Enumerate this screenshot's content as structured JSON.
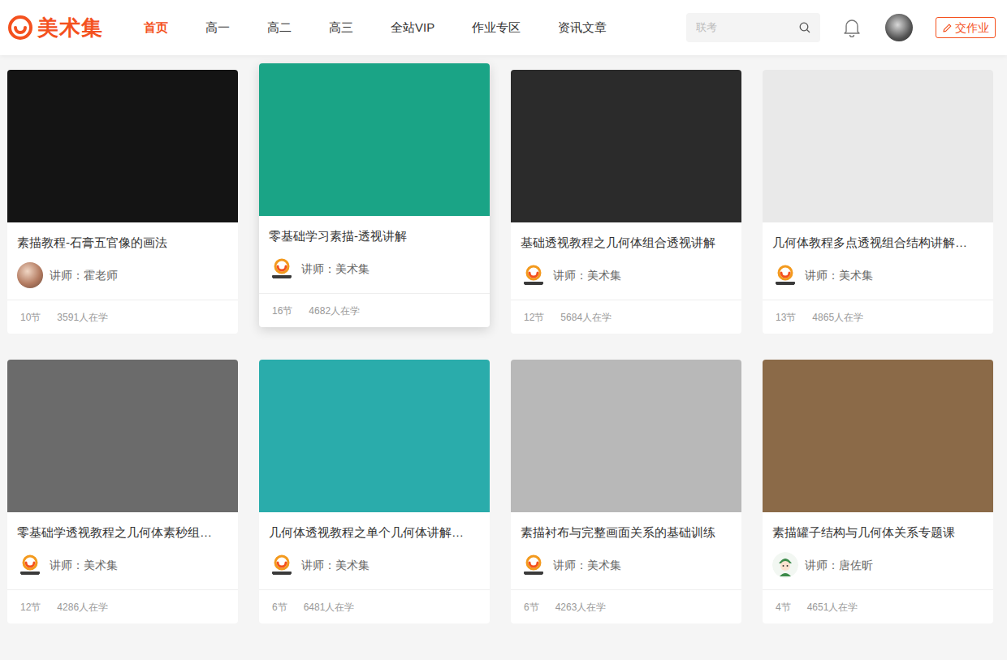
{
  "header": {
    "logo": {
      "text": "美术集"
    },
    "nav": [
      {
        "label": "首页",
        "selected": true
      },
      {
        "label": "高一",
        "selected": false
      },
      {
        "label": "高二",
        "selected": false
      },
      {
        "label": "高三",
        "selected": false
      },
      {
        "label": "全站VIP",
        "selected": false
      },
      {
        "label": "作业专区",
        "selected": false
      },
      {
        "label": "资讯文章",
        "selected": false
      }
    ],
    "search": {
      "placeholder": "联考"
    },
    "submit_button": {
      "label": "交作业"
    }
  },
  "courses": [
    {
      "title": "素描教程-石膏五官像的画法",
      "teacher": "讲师：霍老师",
      "kind": "photo",
      "lessons": "10节",
      "learners": "3591人在学",
      "hovered": false,
      "color": "#141414"
    },
    {
      "title": "零基础学习素描-透视讲解",
      "teacher": "讲师：美术集",
      "kind": "logo",
      "lessons": "16节",
      "learners": "4682人在学",
      "hovered": true,
      "color": "#1aa486"
    },
    {
      "title": "基础透视教程之几何体组合透视讲解",
      "teacher": "讲师：美术集",
      "kind": "logo",
      "lessons": "12节",
      "learners": "5684人在学",
      "hovered": false,
      "color": "#2b2b2b"
    },
    {
      "title": "几何体教程多点透视组合结构讲解…",
      "teacher": "讲师：美术集",
      "kind": "logo",
      "lessons": "13节",
      "learners": "4865人在学",
      "hovered": false,
      "color": "#e9e9e9"
    },
    {
      "title": "零基础学透视教程之几何体素秒组…",
      "teacher": "讲师：美术集",
      "kind": "logo",
      "lessons": "12节",
      "learners": "4286人在学",
      "hovered": false,
      "color": "#6b6b6b"
    },
    {
      "title": "几何体透视教程之单个几何体讲解…",
      "teacher": "讲师：美术集",
      "kind": "logo",
      "lessons": "6节",
      "learners": "6481人在学",
      "hovered": false,
      "color": "#2aacab"
    },
    {
      "title": "素描衬布与完整画面关系的基础训练",
      "teacher": "讲师：美术集",
      "kind": "logo",
      "lessons": "6节",
      "learners": "4263人在学",
      "hovered": false,
      "color": "#b8b8b8"
    },
    {
      "title": "素描罐子结构与几何体关系专题课",
      "teacher": "讲师：唐佐昕",
      "kind": "cartoon",
      "lessons": "4节",
      "learners": "4651人在学",
      "hovered": false,
      "color": "#8b6a48"
    }
  ]
}
